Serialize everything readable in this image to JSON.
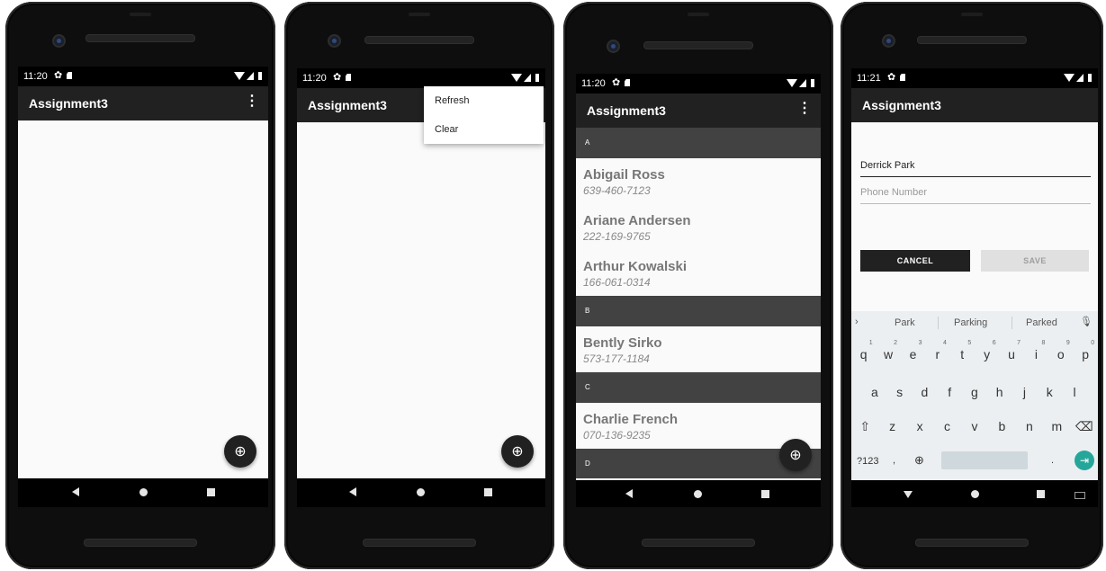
{
  "status_bar": {
    "time_a": "11:20",
    "time_b": "11:20",
    "time_c": "11:20",
    "time_d": "11:21"
  },
  "app": {
    "title": "Assignment3",
    "more_icon": "⋮",
    "fab_icon": "⊕"
  },
  "menu": {
    "items": [
      "Refresh",
      "Clear"
    ]
  },
  "contacts": {
    "sections": [
      {
        "letter": "A",
        "people": [
          {
            "name": "Abigail Ross",
            "phone": "639-460-7123"
          },
          {
            "name": "Ariane Andersen",
            "phone": "222-169-9765"
          },
          {
            "name": "Arthur Kowalski",
            "phone": "166-061-0314"
          }
        ]
      },
      {
        "letter": "B",
        "people": [
          {
            "name": "Bently Sirko",
            "phone": "573-177-1184"
          }
        ]
      },
      {
        "letter": "C",
        "people": [
          {
            "name": "Charlie French",
            "phone": "070-136-9235"
          }
        ]
      },
      {
        "letter": "D",
        "people": []
      }
    ]
  },
  "form": {
    "name_value": "Derrick Park",
    "phone_placeholder": "Phone Number",
    "cancel_label": "CANCEL",
    "save_label": "SAVE"
  },
  "keyboard": {
    "suggestions": [
      "Park",
      "Parking",
      "Parked"
    ],
    "row1": [
      "q",
      "w",
      "e",
      "r",
      "t",
      "y",
      "u",
      "i",
      "o",
      "p"
    ],
    "row1_hints": [
      "1",
      "2",
      "3",
      "4",
      "5",
      "6",
      "7",
      "8",
      "9",
      "0"
    ],
    "row2": [
      "a",
      "s",
      "d",
      "f",
      "g",
      "h",
      "j",
      "k",
      "l"
    ],
    "row3": [
      "z",
      "x",
      "c",
      "v",
      "b",
      "n",
      "m"
    ],
    "symbols_label": "?123",
    "period_label": ".",
    "comma_label": ","
  },
  "colors": {
    "appbar": "#212121",
    "section": "#424242",
    "fab": "#212121",
    "accent_teal": "#26a69a"
  }
}
